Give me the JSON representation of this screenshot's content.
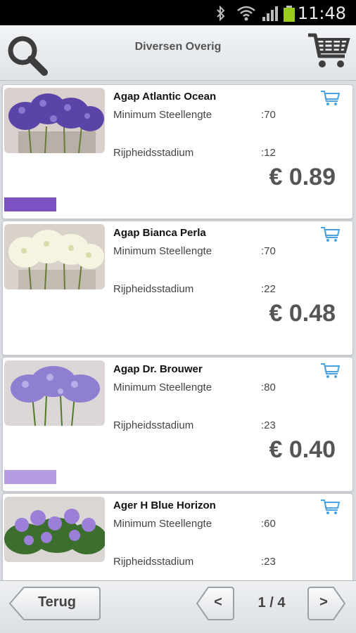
{
  "status_bar": {
    "time": "11:48"
  },
  "header": {
    "title": "Diversen Overig"
  },
  "products": [
    {
      "name": "Agap Atlantic Ocean",
      "label1": "Minimum Steellengte",
      "value1": ":70",
      "label2": "Rijpheidsstadium",
      "value2": ":12",
      "price": "€ 0.89",
      "swatch": "#7b52c1"
    },
    {
      "name": "Agap Bianca Perla",
      "label1": "Minimum Steellengte",
      "value1": ":70",
      "label2": "Rijpheidsstadium",
      "value2": ":22",
      "price": "€ 0.48",
      "swatch": null
    },
    {
      "name": "Agap Dr. Brouwer",
      "label1": "Minimum Steellengte",
      "value1": ":80",
      "label2": "Rijpheidsstadium",
      "value2": ":23",
      "price": "€ 0.40",
      "swatch": "#b69be0"
    },
    {
      "name": "Ager H Blue Horizon",
      "label1": "Minimum Steellengte",
      "value1": ":60",
      "label2": "Rijpheidsstadium",
      "value2": ":23",
      "price": "",
      "swatch": null
    }
  ],
  "footer": {
    "back_label": "Terug",
    "prev_label": "<",
    "page_info": "1 / 4",
    "next_label": ">"
  },
  "colors": {
    "accent_purple": "#7b52c1",
    "light_purple": "#b69be0",
    "cart_blue": "#4aa3df"
  }
}
